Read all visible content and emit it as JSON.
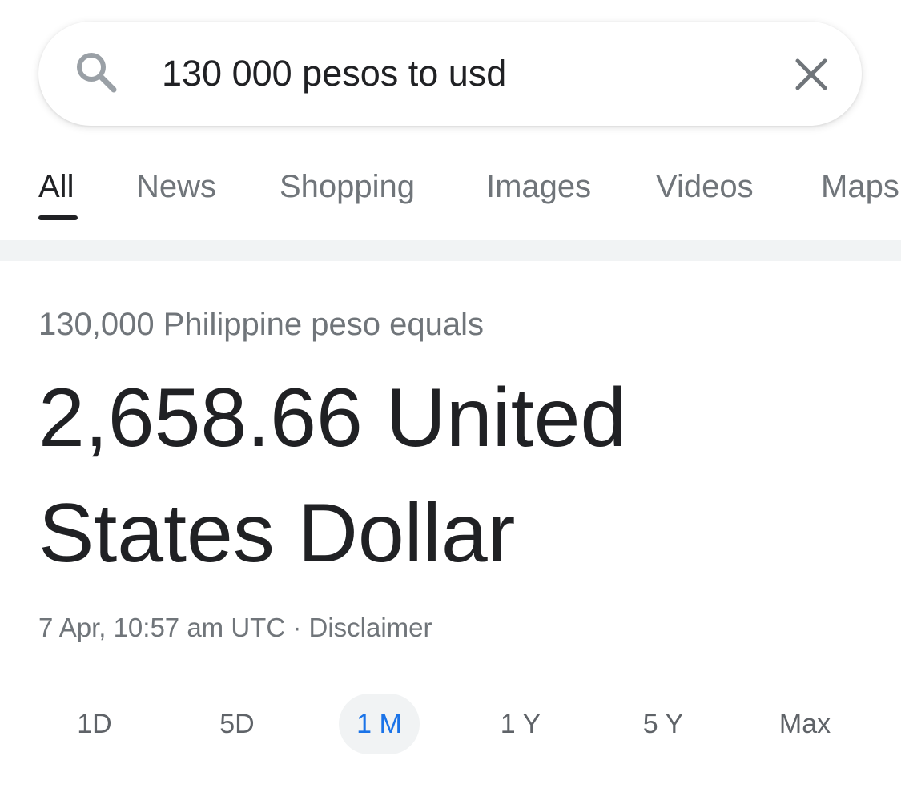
{
  "search": {
    "query": "130 000 pesos to usd",
    "search_icon": "search-icon",
    "clear_icon": "close-icon"
  },
  "tabs": [
    {
      "label": "All",
      "active": true
    },
    {
      "label": "News",
      "active": false
    },
    {
      "label": "Shopping",
      "active": false
    },
    {
      "label": "Images",
      "active": false
    },
    {
      "label": "Videos",
      "active": false
    },
    {
      "label": "Maps",
      "active": false
    }
  ],
  "conversion": {
    "equals_text": "130,000 Philippine peso equals",
    "result_value": "2,658.66 United",
    "result_currency": "States Dollar",
    "timestamp": "7 Apr, 10:57 am UTC",
    "separator": " · ",
    "disclaimer": "Disclaimer"
  },
  "ranges": [
    {
      "label": "1D",
      "active": false
    },
    {
      "label": "5D",
      "active": false
    },
    {
      "label": "1 M",
      "active": true
    },
    {
      "label": "1 Y",
      "active": false
    },
    {
      "label": "5 Y",
      "active": false
    },
    {
      "label": "Max",
      "active": false
    }
  ],
  "colors": {
    "accent": "#1a73e8",
    "text_primary": "#202124",
    "text_secondary": "#70757a"
  }
}
